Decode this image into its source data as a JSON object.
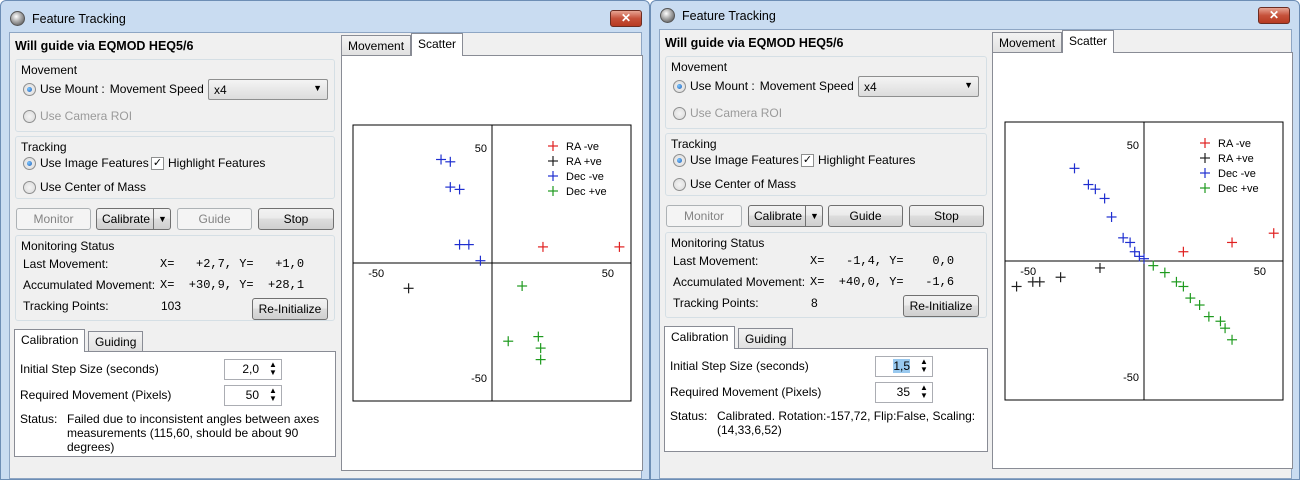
{
  "windows": [
    {
      "title": "Feature Tracking",
      "close_label": "✕",
      "guide_label": "Will guide via EQMOD HEQ5/6",
      "movement": {
        "title": "Movement",
        "use_mount": "Use Mount :",
        "speed_label": "Movement Speed",
        "speed_value": "x4",
        "use_camera_roi": "Use Camera ROI"
      },
      "tracking": {
        "title": "Tracking",
        "use_image_features": "Use Image Features",
        "highlight_features": "Highlight Features",
        "use_center_of_mass": "Use Center of Mass"
      },
      "buttons": {
        "monitor": "Monitor",
        "calibrate": "Calibrate",
        "guide": "Guide",
        "stop": "Stop"
      },
      "buttons_state": {
        "guide_disabled": true
      },
      "monitoring": {
        "title": "Monitoring Status",
        "last_movement_label": "Last Movement:",
        "last_movement_value": "X=   +2,7, Y=   +1,0",
        "accumulated_label": "Accumulated Movement:",
        "accumulated_value": "X=  +30,9, Y=  +28,1",
        "tracking_points_label": "Tracking Points:",
        "tracking_points_value": "103",
        "reinit": "Re-Initialize"
      },
      "bottom_tabs": [
        "Calibration",
        "Guiding"
      ],
      "calibration": {
        "step_label": "Initial Step Size (seconds)",
        "step_value": "2,0",
        "step_selected": false,
        "movement_label": "Required Movement (Pixels)",
        "movement_value": "50",
        "status_label": "Status:",
        "status_text": "Failed due to inconsistent angles between axes measurements (115,60, should be about 90 degrees)"
      },
      "chart_tabs": [
        "Movement",
        "Scatter"
      ],
      "chart_data": {
        "type": "scatter",
        "title": "",
        "xlabel": "",
        "ylabel": "",
        "xlim": [
          -60,
          60
        ],
        "ylim": [
          -60,
          60
        ],
        "x_ticks": [
          "-50",
          "50"
        ],
        "y_ticks": [
          "50",
          "-50"
        ],
        "legend_position": "top-right",
        "series": [
          {
            "name": "RA -ve",
            "color": "#e02020",
            "points": [
              [
                22,
                7
              ],
              [
                55,
                7
              ]
            ]
          },
          {
            "name": "RA +ve",
            "color": "#202020",
            "points": [
              [
                -36,
                -11
              ]
            ]
          },
          {
            "name": "Dec -ve",
            "color": "#1f2fd0",
            "points": [
              [
                -22,
                45
              ],
              [
                -18,
                44
              ],
              [
                -18,
                33
              ],
              [
                -14,
                32
              ],
              [
                -14,
                8
              ],
              [
                -10,
                8
              ],
              [
                -5,
                1
              ]
            ]
          },
          {
            "name": "Dec +ve",
            "color": "#1e9a1e",
            "points": [
              [
                13,
                -10
              ],
              [
                7,
                -34
              ],
              [
                20,
                -32
              ],
              [
                21,
                -37
              ],
              [
                21,
                -42
              ]
            ]
          }
        ]
      }
    },
    {
      "title": "Feature Tracking",
      "close_label": "✕",
      "guide_label": "Will guide via EQMOD HEQ5/6",
      "movement": {
        "title": "Movement",
        "use_mount": "Use Mount :",
        "speed_label": "Movement Speed",
        "speed_value": "x4",
        "use_camera_roi": "Use Camera ROI"
      },
      "tracking": {
        "title": "Tracking",
        "use_image_features": "Use Image Features",
        "highlight_features": "Highlight Features",
        "use_center_of_mass": "Use Center of Mass"
      },
      "buttons": {
        "monitor": "Monitor",
        "calibrate": "Calibrate",
        "guide": "Guide",
        "stop": "Stop"
      },
      "buttons_state": {
        "guide_disabled": false
      },
      "monitoring": {
        "title": "Monitoring Status",
        "last_movement_label": "Last Movement:",
        "last_movement_value": "X=   -1,4, Y=    0,0",
        "accumulated_label": "Accumulated Movement:",
        "accumulated_value": "X=  +40,0, Y=   -1,6",
        "tracking_points_label": "Tracking Points:",
        "tracking_points_value": "8",
        "reinit": "Re-Initialize"
      },
      "bottom_tabs": [
        "Calibration",
        "Guiding"
      ],
      "calibration": {
        "step_label": "Initial Step Size (seconds)",
        "step_value": "1,5",
        "step_selected": true,
        "movement_label": "Required Movement (Pixels)",
        "movement_value": "35",
        "status_label": "Status:",
        "status_text": "Calibrated. Rotation:-157,72, Flip:False, Scaling:(14,33,6,52)"
      },
      "chart_tabs": [
        "Movement",
        "Scatter"
      ],
      "chart_data": {
        "type": "scatter",
        "title": "",
        "xlabel": "",
        "ylabel": "",
        "xlim": [
          -60,
          60
        ],
        "ylim": [
          -60,
          60
        ],
        "x_ticks": [
          "-50",
          "50"
        ],
        "y_ticks": [
          "50",
          "-50"
        ],
        "legend_position": "top-right",
        "series": [
          {
            "name": "RA -ve",
            "color": "#e02020",
            "points": [
              [
                17,
                4
              ],
              [
                38,
                8
              ],
              [
                56,
                12
              ]
            ]
          },
          {
            "name": "RA +ve",
            "color": "#202020",
            "points": [
              [
                -55,
                -11
              ],
              [
                -48,
                -9
              ],
              [
                -45,
                -9
              ],
              [
                -36,
                -7
              ],
              [
                -19,
                -3
              ]
            ]
          },
          {
            "name": "Dec -ve",
            "color": "#1f2fd0",
            "points": [
              [
                -30,
                40
              ],
              [
                -24,
                33
              ],
              [
                -21,
                31
              ],
              [
                -17,
                27
              ],
              [
                -14,
                19
              ],
              [
                -9,
                10
              ],
              [
                -6,
                8
              ],
              [
                -4,
                4
              ],
              [
                -2,
                2
              ],
              [
                0,
                1
              ]
            ]
          },
          {
            "name": "Dec +ve",
            "color": "#1e9a1e",
            "points": [
              [
                4,
                -2
              ],
              [
                9,
                -5
              ],
              [
                14,
                -9
              ],
              [
                17,
                -11
              ],
              [
                20,
                -16
              ],
              [
                24,
                -19
              ],
              [
                28,
                -24
              ],
              [
                33,
                -26
              ],
              [
                35,
                -29
              ],
              [
                38,
                -34
              ]
            ]
          }
        ]
      }
    }
  ]
}
